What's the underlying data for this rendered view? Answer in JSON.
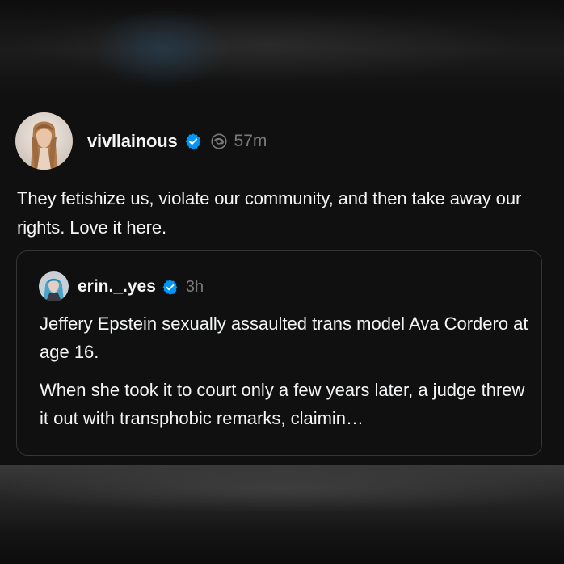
{
  "post": {
    "username": "vivllainous",
    "time": "57m",
    "text": "They fetishize us, violate our community, and then take away our rights. Love it here.",
    "verified_icon": "verified-badge-icon",
    "threads_icon": "threads-icon"
  },
  "quoted_post": {
    "username": "erin._.yes",
    "time": "3h",
    "paragraph_1": "Jeffery Epstein sexually assaulted trans model Ava Cordero at age 16.",
    "paragraph_2": "When she took it to court only a few years later, a judge threw it out with transphobic remarks, claimin…",
    "verified_icon": "verified-badge-icon"
  },
  "colors": {
    "background": "#101010",
    "text": "#f3f5f7",
    "muted": "#7a7a7a",
    "verified_blue": "#0095f6",
    "card_border": "#333638"
  }
}
